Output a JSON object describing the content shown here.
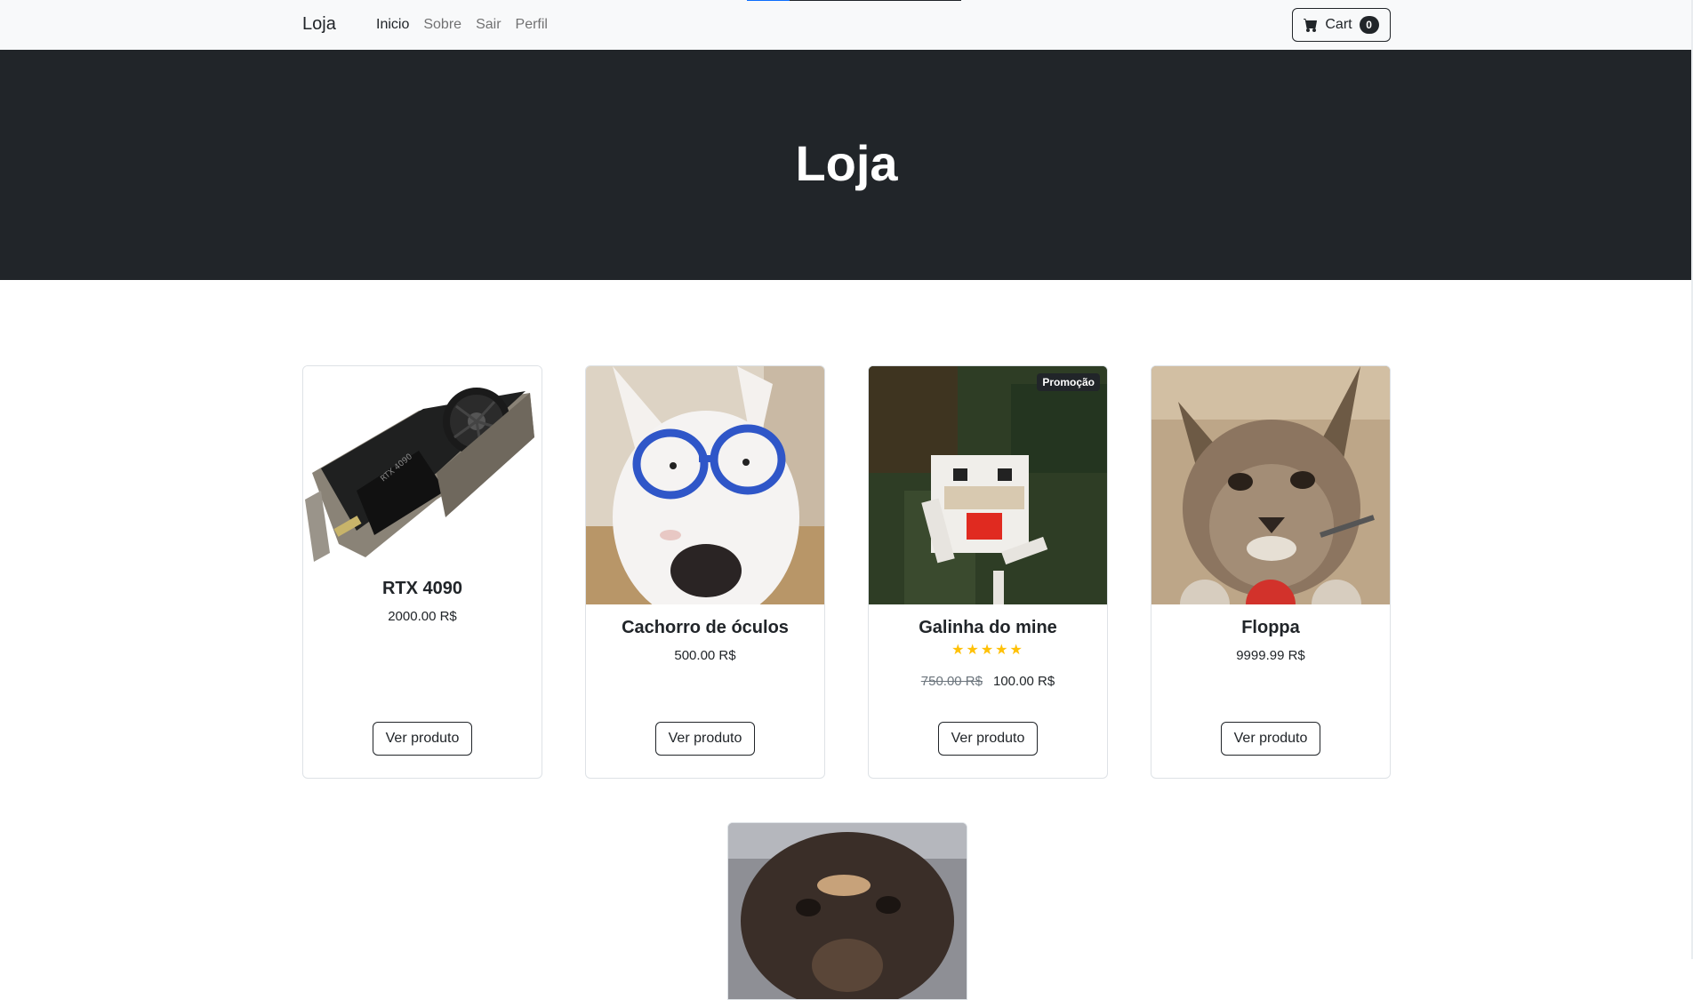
{
  "navbar": {
    "brand": "Loja",
    "links": [
      {
        "label": "Inicio",
        "active": true
      },
      {
        "label": "Sobre",
        "active": false
      },
      {
        "label": "Sair",
        "active": false
      },
      {
        "label": "Perfil",
        "active": false
      }
    ],
    "cart": {
      "label": "Cart",
      "count": "0",
      "icon": "cart-icon"
    },
    "page_load_progress": 0.2
  },
  "hero": {
    "title": "Loja"
  },
  "products": [
    {
      "name": "RTX 4090",
      "price": "2000.00 R$",
      "button": "Ver produto"
    },
    {
      "name": "Cachorro de óculos",
      "price": "500.00 R$",
      "button": "Ver produto"
    },
    {
      "name": "Galinha do mine",
      "badge": "Promoção",
      "stars": 5,
      "old_price": "750.00 R$",
      "price": "100.00 R$",
      "button": "Ver produto"
    },
    {
      "name": "Floppa",
      "price": "9999.99 R$",
      "button": "Ver produto"
    }
  ],
  "colors": {
    "dark": "#212529",
    "navbar_bg": "#f8f9fa",
    "star": "#ffc107",
    "progress": "#0d6efd"
  }
}
